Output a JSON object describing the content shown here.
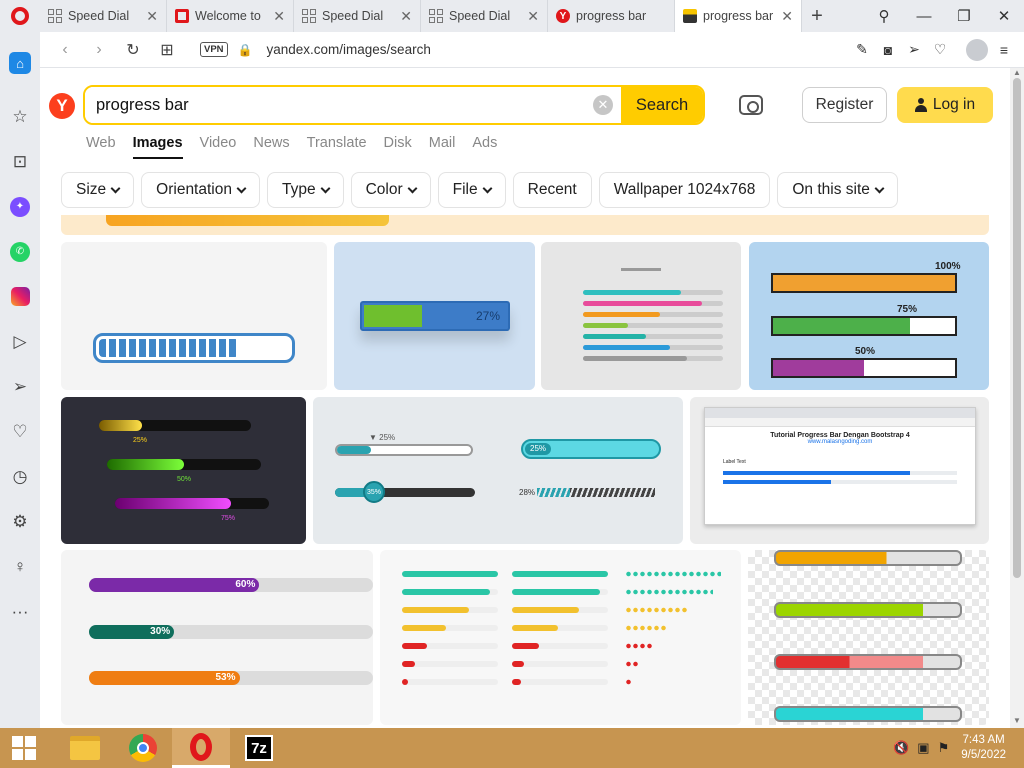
{
  "tabs": [
    {
      "label": "Speed Dial",
      "icon": "speed-dial-icon",
      "active": false
    },
    {
      "label": "Welcome to",
      "icon": "opera-icon",
      "active": false
    },
    {
      "label": "Speed Dial",
      "icon": "speed-dial-icon",
      "active": false
    },
    {
      "label": "Speed Dial",
      "icon": "speed-dial-icon",
      "active": false
    },
    {
      "label": "progress bar",
      "icon": "yandex-icon",
      "active": false
    },
    {
      "label": "progress bar",
      "icon": "image-icon",
      "active": true
    }
  ],
  "address": {
    "vpn": "VPN",
    "url": "yandex.com/images/search"
  },
  "search": {
    "query": "progress bar",
    "button": "Search"
  },
  "logo": "Y",
  "auth": {
    "register": "Register",
    "login": "Log in"
  },
  "services": [
    "Web",
    "Images",
    "Video",
    "News",
    "Translate",
    "Disk",
    "Mail",
    "Ads"
  ],
  "filters": [
    {
      "label": "Size",
      "dropdown": true
    },
    {
      "label": "Orientation",
      "dropdown": true
    },
    {
      "label": "Type",
      "dropdown": true
    },
    {
      "label": "Color",
      "dropdown": true
    },
    {
      "label": "File",
      "dropdown": true
    },
    {
      "label": "Recent",
      "dropdown": false
    },
    {
      "label": "Wallpaper 1024x768",
      "dropdown": false
    },
    {
      "label": "On this site",
      "dropdown": true
    }
  ],
  "results": {
    "r1c2_pct": "27%",
    "r1c4": [
      "100%",
      "75%",
      "50%"
    ],
    "r1c4_values": [
      1.0,
      0.75,
      0.5
    ],
    "r2c1": [
      "25%",
      "50%",
      "75%"
    ],
    "r2c2": {
      "top_left": "25%",
      "top_right": "25%",
      "circle": "35%",
      "bottom_right": "28%"
    },
    "r2c3": {
      "title": "Tutorial Progress Bar Dengan Bootstrap 4",
      "link": "www.malasngoding.com",
      "label": "Label Text"
    },
    "r3c1": [
      {
        "label": "60%",
        "value": 0.6,
        "color": "#7b2aa8"
      },
      {
        "label": "30%",
        "value": 0.3,
        "color": "#0f6e5c"
      },
      {
        "label": "53%",
        "value": 0.53,
        "color": "#ef7d12"
      }
    ]
  },
  "taskbar": {
    "time": "7:43 AM",
    "date": "9/5/2022",
    "apps": [
      "file-explorer",
      "chrome",
      "opera",
      "7zip"
    ],
    "sevenzip": "7z"
  }
}
